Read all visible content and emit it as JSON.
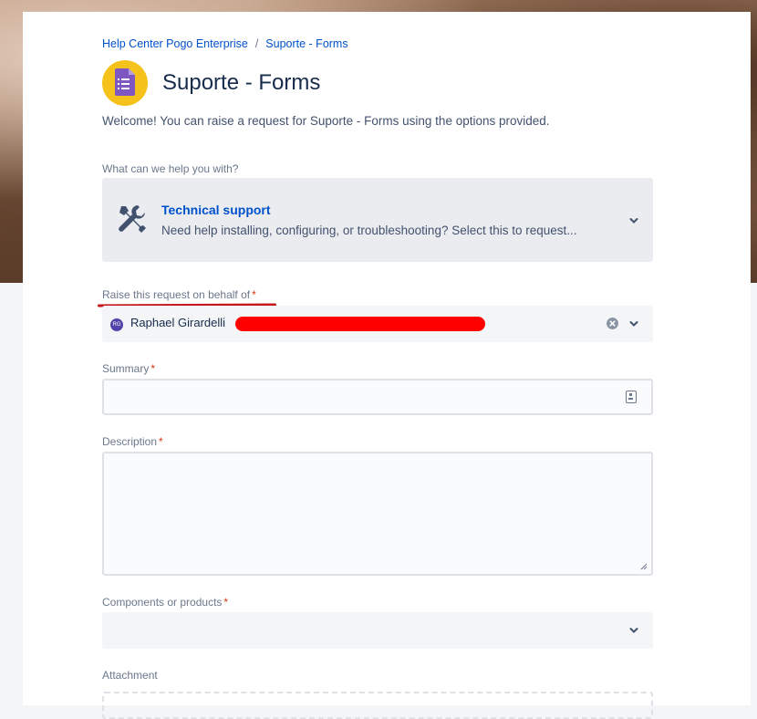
{
  "breadcrumb": {
    "help_center": "Help Center Pogo Enterprise",
    "separator": "/",
    "current": "Suporte - Forms"
  },
  "page": {
    "title": "Suporte - Forms",
    "welcome": "Welcome! You can raise a request for Suporte - Forms using the options provided."
  },
  "request_type": {
    "label": "What can we help you with?",
    "title": "Technical support",
    "description": "Need help installing, configuring, or troubleshooting? Select this to request..."
  },
  "behalf": {
    "label": "Raise this request on behalf of",
    "required_mark": "*",
    "avatar_initials": "RG",
    "value": "Raphael Girardelli"
  },
  "summary": {
    "label": "Summary",
    "required_mark": "*",
    "value": ""
  },
  "description": {
    "label": "Description",
    "required_mark": "*",
    "value": ""
  },
  "components": {
    "label": "Components or products",
    "required_mark": "*",
    "value": ""
  },
  "attachment": {
    "label": "Attachment"
  },
  "colors": {
    "link": "#0052cc",
    "required": "#de350b",
    "redaction": "#ff0000",
    "annotation_underline": "#c4161c",
    "logo_bg": "#f5c21b",
    "logo_doc": "#7e57c2",
    "avatar": "#5243aa"
  },
  "icons": {
    "logo": "google-forms-icon",
    "request_type": "tools-icon",
    "dropdown": "chevron-down-icon",
    "clear": "clear-icon",
    "summary_field": "contact-card-icon",
    "resize": "resize-grip-icon"
  }
}
